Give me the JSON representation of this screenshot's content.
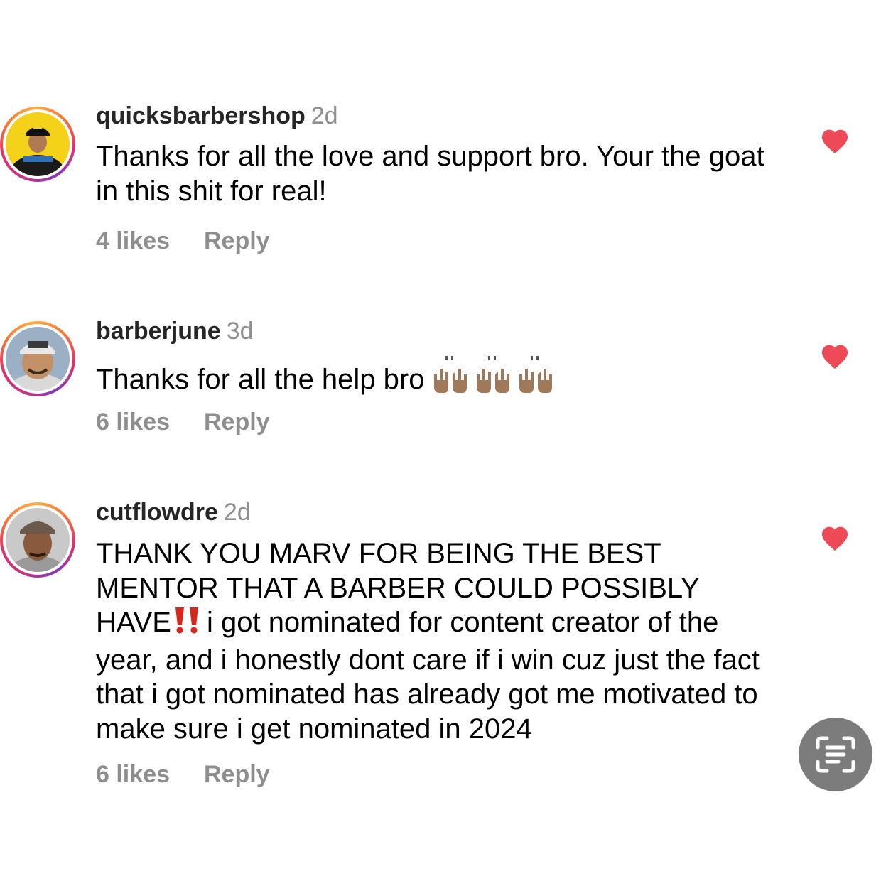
{
  "comments": [
    {
      "username": "quicksbarbershop",
      "time": "2d",
      "text": "Thanks for all the love and support bro. Your the goat in this shit for real!",
      "likes": "4 likes",
      "reply": "Reply",
      "liked": true
    },
    {
      "username": "barberjune",
      "time": "3d",
      "text": "Thanks for all the help bro",
      "emoji": "raising-hands x3",
      "likes": "6 likes",
      "reply": "Reply",
      "liked": true
    },
    {
      "username": "cutflowdre",
      "time": "2d",
      "text_part1": "THANK YOU MARV FOR BEING THE BEST MENTOR THAT A BARBER COULD POSSIBLY HAVE",
      "text_part2": "i got nominated for content creator of the year, and i honestly dont care if i win cuz just the fact that i got nominated has already got me motivated to make sure i get nominated in 2024",
      "likes": "6 likes",
      "reply": "Reply",
      "liked": true
    }
  ],
  "colors": {
    "heart": "#ed4956",
    "muted": "#8e8e8e",
    "scan_button": "#7c7c7c"
  },
  "icons": {
    "heart": "heart-filled-icon",
    "scan": "text-scan-icon"
  }
}
